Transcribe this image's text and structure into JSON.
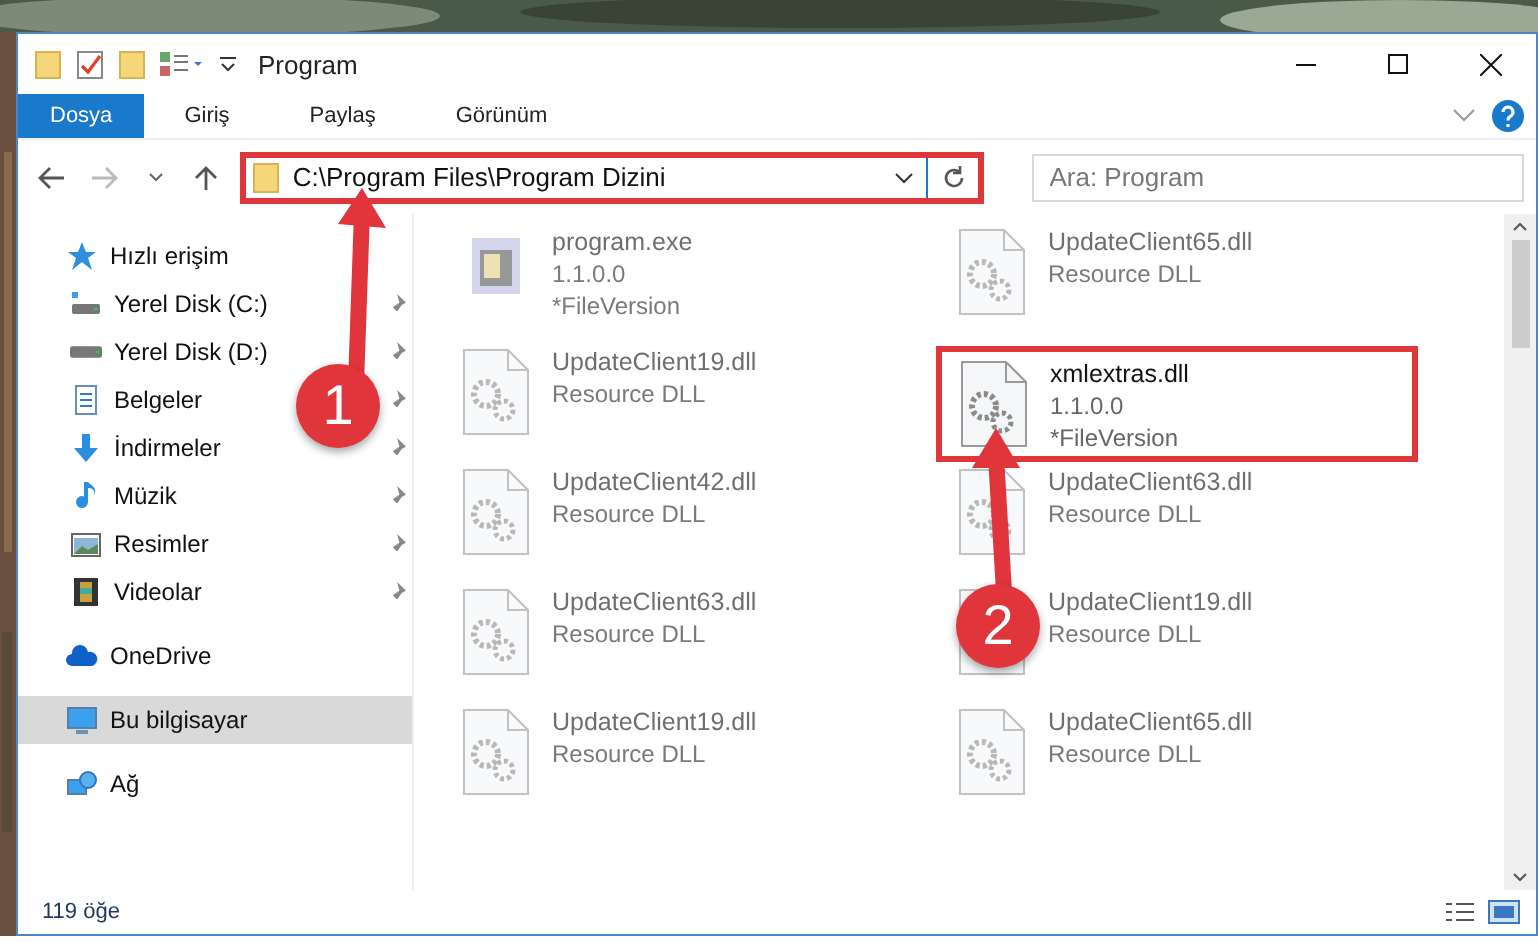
{
  "window": {
    "title": "Program"
  },
  "ribbon_tabs": [
    {
      "label": "Dosya",
      "selected": true
    },
    {
      "label": "Giriş",
      "selected": false
    },
    {
      "label": "Paylaş",
      "selected": false
    },
    {
      "label": "Görünüm",
      "selected": false
    }
  ],
  "address": {
    "path": "C:\\Program Files\\Program Dizini",
    "highlighted": true
  },
  "search": {
    "placeholder": "Ara: Program"
  },
  "sidebar": {
    "items": [
      {
        "label": "Hızlı erişim",
        "kind": "star",
        "selected": false,
        "children": [
          {
            "label": "Yerel Disk (C:)",
            "kind": "drive-c",
            "pinned": true,
            "selected": false
          },
          {
            "label": "Yerel Disk (D:)",
            "kind": "drive",
            "pinned": true,
            "selected": false
          },
          {
            "label": "Belgeler",
            "kind": "docs",
            "pinned": true,
            "selected": false
          },
          {
            "label": "İndirmeler",
            "kind": "download",
            "pinned": true,
            "selected": false
          },
          {
            "label": "Müzik",
            "kind": "music",
            "pinned": true,
            "selected": false
          },
          {
            "label": "Resimler",
            "kind": "pictures",
            "pinned": true,
            "selected": false
          },
          {
            "label": "Videolar",
            "kind": "videos",
            "pinned": true,
            "selected": false
          }
        ]
      },
      {
        "label": "OneDrive",
        "kind": "cloud",
        "selected": false
      },
      {
        "label": "Bu bilgisayar",
        "kind": "computer",
        "selected": true
      },
      {
        "label": "Ağ",
        "kind": "network",
        "selected": false
      }
    ]
  },
  "files": [
    {
      "name": "program.exe",
      "lines": [
        "1.1.0.0",
        "*FileVersion"
      ],
      "kind": "exe",
      "blurred": true,
      "highlighted": false
    },
    {
      "name": "UpdateClient65.dll",
      "lines": [
        "Resource DLL"
      ],
      "kind": "dll",
      "blurred": true,
      "highlighted": false
    },
    {
      "name": "UpdateClient19.dll",
      "lines": [
        "Resource DLL"
      ],
      "kind": "dll",
      "blurred": true,
      "highlighted": false
    },
    {
      "name": "xmlextras.dll",
      "lines": [
        "1.1.0.0",
        "*FileVersion"
      ],
      "kind": "dll",
      "blurred": false,
      "highlighted": true
    },
    {
      "name": "UpdateClient42.dll",
      "lines": [
        "Resource DLL"
      ],
      "kind": "dll",
      "blurred": true,
      "highlighted": false
    },
    {
      "name": "UpdateClient63.dll",
      "lines": [
        "Resource DLL"
      ],
      "kind": "dll",
      "blurred": true,
      "highlighted": false
    },
    {
      "name": "UpdateClient63.dll",
      "lines": [
        "Resource DLL"
      ],
      "kind": "dll",
      "blurred": true,
      "highlighted": false
    },
    {
      "name": "UpdateClient19.dll",
      "lines": [
        "Resource DLL"
      ],
      "kind": "dll",
      "blurred": true,
      "highlighted": false
    },
    {
      "name": "UpdateClient19.dll",
      "lines": [
        "Resource DLL"
      ],
      "kind": "dll",
      "blurred": true,
      "highlighted": false
    },
    {
      "name": "UpdateClient65.dll",
      "lines": [
        "Resource DLL"
      ],
      "kind": "dll",
      "blurred": true,
      "highlighted": false
    }
  ],
  "status_bar": {
    "count": "119 öğe"
  },
  "annotations": [
    {
      "number": "1"
    },
    {
      "number": "2"
    }
  ]
}
